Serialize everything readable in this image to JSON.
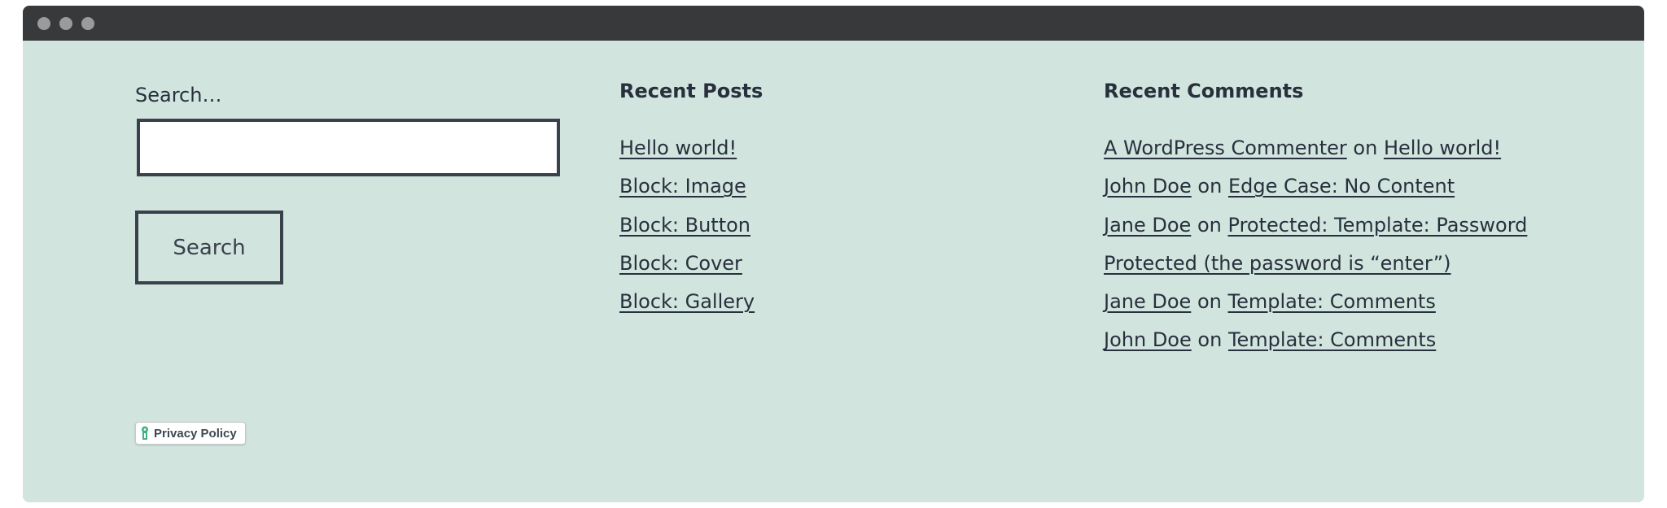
{
  "window": {
    "colors": {
      "titlebar": "#38393b",
      "background": "#d1e4dd",
      "text": "#28303d",
      "dots": "#9b9b9d"
    }
  },
  "search": {
    "label": "Search…",
    "input_value": "",
    "input_placeholder": "",
    "button_label": "Search"
  },
  "recent_posts": {
    "title": "Recent Posts",
    "items": [
      {
        "label": "Hello world!"
      },
      {
        "label": "Block: Image"
      },
      {
        "label": "Block: Button"
      },
      {
        "label": "Block: Cover"
      },
      {
        "label": "Block: Gallery"
      }
    ]
  },
  "recent_comments": {
    "title": "Recent Comments",
    "items": [
      {
        "author": "A WordPress Commenter",
        "connector": "on",
        "post": "Hello world!"
      },
      {
        "author": "John Doe",
        "connector": "on",
        "post": "Edge Case: No Content"
      },
      {
        "author": "Jane Doe",
        "connector": "on",
        "post": "Protected: Template: Password"
      },
      {
        "author": "",
        "connector": "",
        "post": "Protected (the password is “enter”)"
      },
      {
        "author": "Jane Doe",
        "connector": "on",
        "post": "Template: Comments"
      },
      {
        "author": "John Doe",
        "connector": "on",
        "post": "Template: Comments"
      }
    ]
  },
  "privacy_badge": {
    "label": "Privacy Policy",
    "icon": "keyhole-icon",
    "icon_color": "#3fb37f"
  }
}
